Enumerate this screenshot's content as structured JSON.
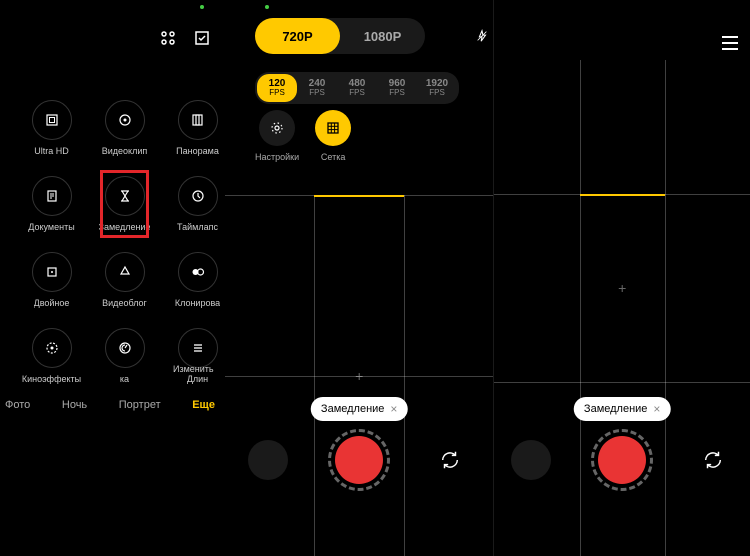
{
  "modes": [
    {
      "id": "ultra-hd",
      "label": "Ultra HD"
    },
    {
      "id": "videoclip",
      "label": "Видеоклип"
    },
    {
      "id": "panorama",
      "label": "Панорама"
    },
    {
      "id": "documents",
      "label": "Документы"
    },
    {
      "id": "slowmo",
      "label": "Замедление",
      "highlighted": true
    },
    {
      "id": "timelapse",
      "label": "Таймлапс"
    },
    {
      "id": "dual",
      "label": "Двойное"
    },
    {
      "id": "vlog",
      "label": "Видеоблог"
    },
    {
      "id": "clone",
      "label": "Клонирова"
    },
    {
      "id": "cinema",
      "label": "Киноэффекты"
    },
    {
      "id": "ka",
      "label": "ка"
    },
    {
      "id": "long",
      "label": "Длин"
    },
    {
      "id": "edit",
      "label": "Изменить"
    }
  ],
  "tabs": [
    {
      "id": "photo",
      "label": "Фото"
    },
    {
      "id": "night",
      "label": "Ночь"
    },
    {
      "id": "portrait",
      "label": "Портрет"
    },
    {
      "id": "more",
      "label": "Еще",
      "active": true
    }
  ],
  "resolution": {
    "options": [
      {
        "id": "720p",
        "label": "720P",
        "active": true
      },
      {
        "id": "1080p",
        "label": "1080P"
      }
    ]
  },
  "fps": {
    "unit": "FPS",
    "options": [
      {
        "value": "120",
        "active": true
      },
      {
        "value": "240"
      },
      {
        "value": "480"
      },
      {
        "value": "960"
      },
      {
        "value": "1920"
      }
    ]
  },
  "settings_pills": [
    {
      "id": "settings",
      "label": "Настройки"
    },
    {
      "id": "grid",
      "label": "Сетка",
      "active": true
    }
  ],
  "active_mode_chip": "Замедление",
  "colors": {
    "accent": "#ffc900",
    "record": "#e93434",
    "highlight": "#e3262a"
  }
}
